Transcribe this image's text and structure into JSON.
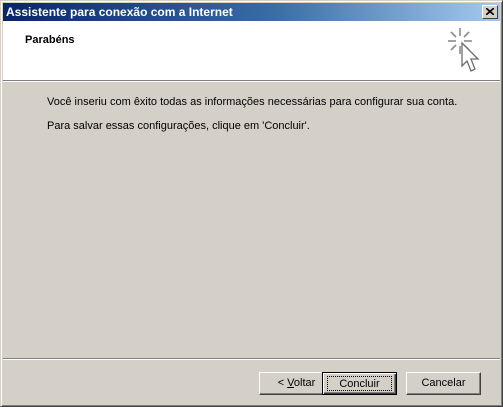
{
  "window": {
    "title": "Assistente para conexão com a Internet",
    "close_glyph": "×"
  },
  "header": {
    "title": "Parabéns",
    "icon": "wizard-cursor-sparkle-icon"
  },
  "body": {
    "message1": "Você inseriu com êxito todas as informações necessárias para configurar sua conta.",
    "message2": "Para salvar essas configurações, clique em 'Concluir'."
  },
  "buttons": {
    "back_arrow": "< ",
    "back_mnemonic": "V",
    "back_rest": "oltar",
    "finish": "Concluir",
    "cancel": "Cancelar"
  }
}
